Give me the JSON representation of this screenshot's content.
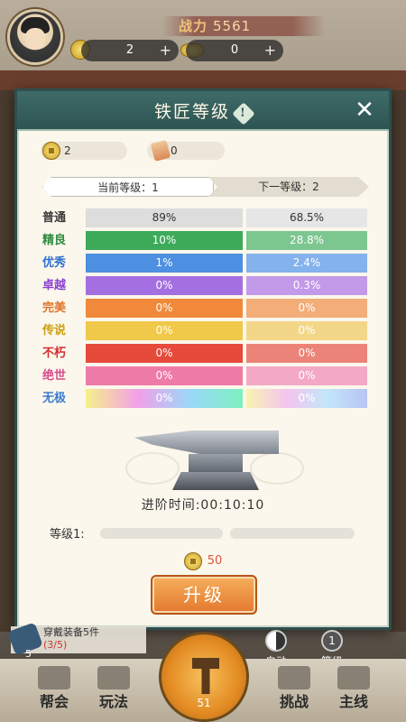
{
  "hud": {
    "power_label": "战力",
    "power_value": "5561",
    "coins": "2",
    "ingots": "0",
    "plus": "+"
  },
  "dialog": {
    "title": "铁匠等级",
    "info": "!",
    "close": "✕",
    "resource_coins": "2",
    "resource_scroll": "0",
    "current_level": "当前等级：1",
    "next_level": "下一等级：2",
    "rarities": [
      {
        "name": "普通",
        "name_color": "#3a3a3a",
        "cur": "89%",
        "next": "68.5%",
        "cur_bg": "#dddddd",
        "next_bg": "#e6e6e6",
        "text_color": "#333333"
      },
      {
        "name": "精良",
        "name_color": "#2e8b3e",
        "cur": "10%",
        "next": "28.8%",
        "cur_bg": "#3daa5a",
        "next_bg": "#7cc690",
        "text_color": "#ffffff"
      },
      {
        "name": "优秀",
        "name_color": "#2f6fd0",
        "cur": "1%",
        "next": "2.4%",
        "cur_bg": "#4d8fe0",
        "next_bg": "#84b2ec",
        "text_color": "#ffffff"
      },
      {
        "name": "卓越",
        "name_color": "#8a3fd2",
        "cur": "0%",
        "next": "0.3%",
        "cur_bg": "#a46fe0",
        "next_bg": "#c29ae9",
        "text_color": "#ffffff"
      },
      {
        "name": "完美",
        "name_color": "#e07226",
        "cur": "0%",
        "next": "0%",
        "cur_bg": "#f08a3a",
        "next_bg": "#f2ad79",
        "text_color": "#ffffff"
      },
      {
        "name": "传说",
        "name_color": "#caa00f",
        "cur": "0%",
        "next": "0%",
        "cur_bg": "#f0c84a",
        "next_bg": "#f3d788",
        "text_color": "#ffffff"
      },
      {
        "name": "不朽",
        "name_color": "#d42c2c",
        "cur": "0%",
        "next": "0%",
        "cur_bg": "#e54a3a",
        "next_bg": "#ec8378",
        "text_color": "#ffffff"
      },
      {
        "name": "绝世",
        "name_color": "#d84a8a",
        "cur": "0%",
        "next": "0%",
        "cur_bg": "#ee7aa8",
        "next_bg": "#f3a9c6",
        "text_color": "#ffffff"
      },
      {
        "name": "无极",
        "name_color": "#3a7ad0",
        "cur": "0%",
        "next": "0%",
        "cur_bg": "linear-gradient(90deg,#f5f08a,#f2a0e8,#9ad8f8,#7ef0c0)",
        "next_bg": "linear-gradient(90deg,#f8f3b0,#f4c4ee,#c2e6fa,#b8c4f4)",
        "text_color": "#ffffff"
      }
    ],
    "advance_time": "进阶时间:00:10:10",
    "level_label": "等级1:",
    "progress_fraction": 0,
    "cost": "50",
    "upgrade_button": "升级"
  },
  "bottom": {
    "quest_text": "穿戴装备5件",
    "quest_progress": "(3/5)",
    "quest_num": "5",
    "auto_label": "自动",
    "level_count": "1",
    "level_label": "等级",
    "forge_count": "51",
    "nav": [
      "帮会",
      "玩法",
      "挑战",
      "主线"
    ]
  }
}
